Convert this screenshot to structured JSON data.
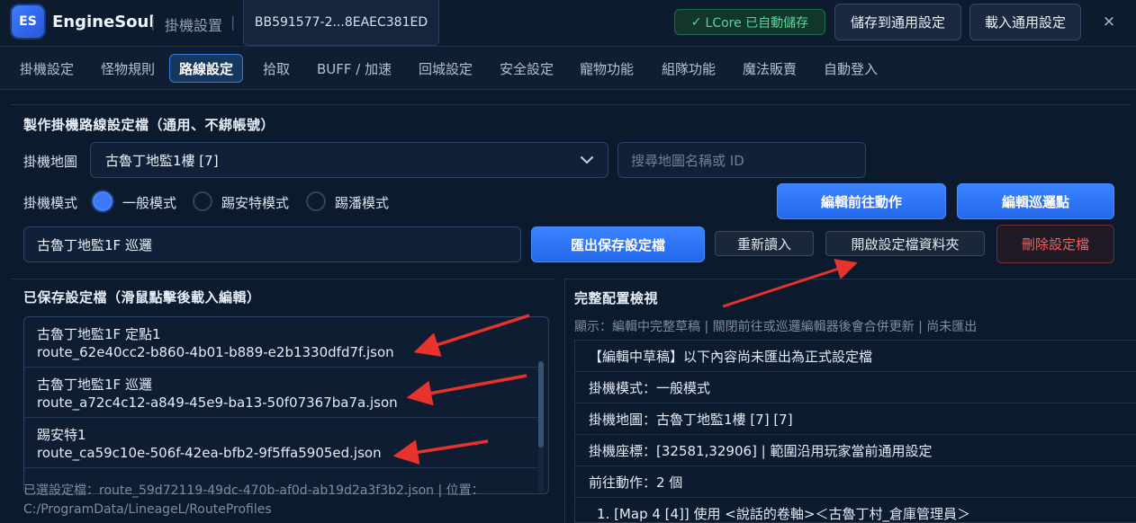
{
  "title_bar": {
    "logo_text": "ES",
    "app_name": "EngineSoul",
    "separator": "|",
    "subtitle": "掛機設置",
    "account_id": "BB591577-2...8EAEC381ED",
    "autosave_check": "✓",
    "autosave_text": "LCore 已自動儲存",
    "save_general_btn": "儲存到通用設定",
    "load_general_btn": "載入通用設定",
    "close_icon": "×"
  },
  "tabs": [
    "掛機設定",
    "怪物規則",
    "路線設定",
    "拾取",
    "BUFF / 加速",
    "回城設定",
    "安全設定",
    "寵物功能",
    "組隊功能",
    "魔法販賣",
    "自動登入"
  ],
  "active_tab": "路線設定",
  "route_maker": {
    "section_title": "製作掛機路線設定檔（通用、不綁帳號）",
    "map_label": "掛機地圖",
    "map_selected": "古魯丁地監1樓 [7]",
    "map_search_placeholder": "搜尋地圖名稱或 ID",
    "mode_label": "掛機模式",
    "modes": [
      "一般模式",
      "踢安特模式",
      "踢潘模式"
    ],
    "selected_mode": "一般模式",
    "edit_forward_btn": "編輯前往動作",
    "edit_patrol_btn": "編輯巡邏點",
    "profile_name_value": "古魯丁地監1F 巡邏",
    "export_btn": "匯出保存設定檔",
    "reload_btn": "重新讀入",
    "open_folder_btn": "開啟設定檔資料夾",
    "delete_btn": "刪除設定檔"
  },
  "saved_profiles": {
    "section_title": "已保存設定檔（滑鼠點擊後載入編輯）",
    "items": [
      {
        "name": "古魯丁地監1F 定點1",
        "file": "route_62e40cc2-b860-4b01-b889-e2b1330dfd7f.json"
      },
      {
        "name": "古魯丁地監1F 巡邏",
        "file": "route_a72c4c12-a849-45e9-ba13-50f07367ba7a.json"
      },
      {
        "name": "踢安特1",
        "file": "route_ca59c10e-506f-42ea-bfb2-9f5ffa5905ed.json"
      }
    ],
    "selected_info": "已選設定檔：route_59d72119-49dc-470b-af0d-ab19d2a3f3b2.json | 位置：C:/ProgramData/LineageL/RouteProfiles"
  },
  "full_preview": {
    "section_title": "完整配置檢視",
    "hint": "顯示：編輯中完整草稿 | 關閉前往或巡邏編輯器後會合併更新 | 尚未匯出",
    "lines": [
      "【編輯中草稿】以下內容尚未匯出為正式設定檔",
      "掛機模式：一般模式",
      "掛機地圖：古魯丁地監1樓 [7] [7]",
      "掛機座標：[32581,32906] | 範圍沿用玩家當前通用設定",
      "前往動作：2 個",
      "1. [Map 4 [4]] 使用 <說話的卷軸>＜古魯丁村_倉庫管理員＞"
    ]
  },
  "colors": {
    "background": "#0c1a2e",
    "accent_blue": "#2f74f5",
    "autosave_green": "#58d69a",
    "danger_red": "#ff5b5b",
    "annotation_arrow": "#e8322c"
  }
}
